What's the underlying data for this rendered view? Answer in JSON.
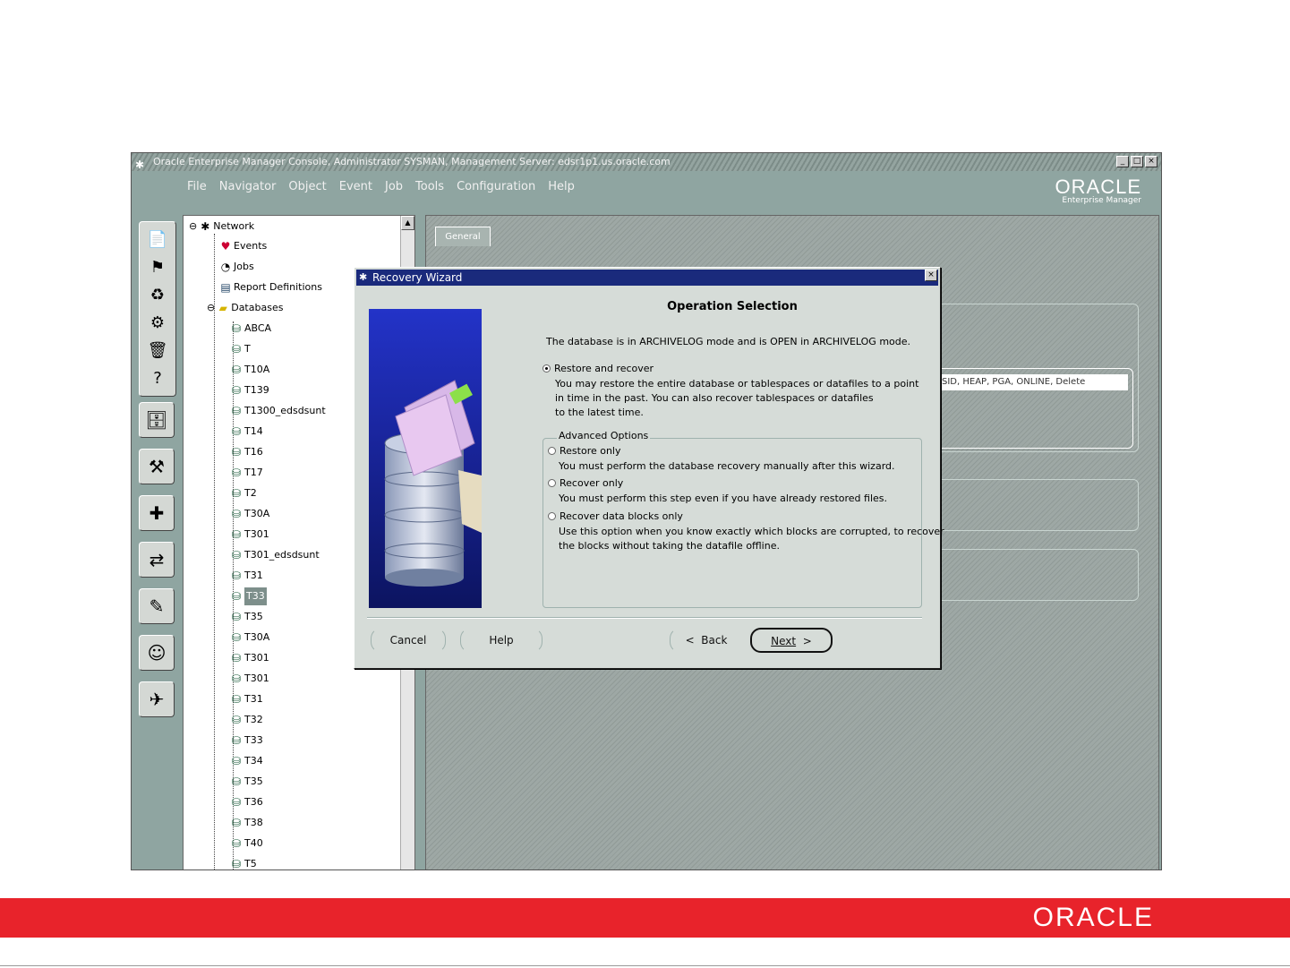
{
  "window": {
    "title": "Oracle Enterprise Manager Console, Administrator SYSMAN, Management Server: edsr1p1.us.oracle.com",
    "controls": [
      "_",
      "□",
      "×"
    ]
  },
  "menu": [
    "File",
    "Navigator",
    "Object",
    "Event",
    "Job",
    "Tools",
    "Configuration",
    "Help"
  ],
  "brand": {
    "wordmark": "ORACLE",
    "subtitle": "Enterprise Manager"
  },
  "toolbar_icons": [
    "new-icon",
    "launch-icon",
    "refresh-icon",
    "discover-icon",
    "trash-icon",
    "help-icon",
    "database-tool-icon",
    "tuning-icon",
    "diagnostics-icon",
    "change-management-icon",
    "configuration-icon",
    "user-icon",
    "wizard-icon"
  ],
  "tree": {
    "root": "Network",
    "items": [
      {
        "label": "Events",
        "level": 1,
        "icon": "events-icon"
      },
      {
        "label": "Jobs",
        "level": 1,
        "icon": "jobs-icon"
      },
      {
        "label": "Report Definitions",
        "level": 1,
        "icon": "report-icon"
      },
      {
        "label": "Databases",
        "level": 1,
        "icon": "folder-icon"
      },
      {
        "label": "ABCA",
        "level": 2,
        "icon": "database-icon"
      },
      {
        "label": "T",
        "level": 2,
        "icon": "database-icon"
      },
      {
        "label": "T10A",
        "level": 2,
        "icon": "database-icon"
      },
      {
        "label": "T139",
        "level": 2,
        "icon": "database-icon"
      },
      {
        "label": "T1300_edsdsunt",
        "level": 2,
        "icon": "database-icon"
      },
      {
        "label": "T14",
        "level": 2,
        "icon": "database-icon"
      },
      {
        "label": "T16",
        "level": 2,
        "icon": "database-icon"
      },
      {
        "label": "T17",
        "level": 2,
        "icon": "database-icon"
      },
      {
        "label": "T2",
        "level": 2,
        "icon": "database-icon"
      },
      {
        "label": "T30A",
        "level": 2,
        "icon": "database-icon"
      },
      {
        "label": "T301",
        "level": 2,
        "icon": "database-icon"
      },
      {
        "label": "T301_edsdsunt",
        "level": 2,
        "icon": "database-icon"
      },
      {
        "label": "T31",
        "level": 2,
        "icon": "database-icon"
      },
      {
        "label": "T33",
        "level": 2,
        "icon": "database-icon",
        "selected": true
      },
      {
        "label": "T35",
        "level": 2,
        "icon": "database-icon"
      },
      {
        "label": "T30A",
        "level": 2,
        "icon": "database-icon"
      },
      {
        "label": "T301",
        "level": 2,
        "icon": "database-icon"
      },
      {
        "label": "T301",
        "level": 2,
        "icon": "database-icon"
      },
      {
        "label": "T31",
        "level": 2,
        "icon": "database-icon"
      },
      {
        "label": "T32",
        "level": 2,
        "icon": "database-icon"
      },
      {
        "label": "T33",
        "level": 2,
        "icon": "database-icon"
      },
      {
        "label": "T34",
        "level": 2,
        "icon": "database-icon"
      },
      {
        "label": "T35",
        "level": 2,
        "icon": "database-icon"
      },
      {
        "label": "T36",
        "level": 2,
        "icon": "database-icon"
      },
      {
        "label": "T38",
        "level": 2,
        "icon": "database-icon"
      },
      {
        "label": "T40",
        "level": 2,
        "icon": "database-icon"
      },
      {
        "label": "T5",
        "level": 2,
        "icon": "database-icon"
      }
    ]
  },
  "right_panel": {
    "tab": "General",
    "field_value": "SID, HEAP, PGA, ONLINE, Delete"
  },
  "dialog": {
    "title": "Recovery Wizard",
    "heading": "Operation Selection",
    "intro": "The database is in ARCHIVELOG mode and is OPEN in ARCHIVELOG mode.",
    "options": [
      {
        "label": "Restore and recover",
        "checked": true,
        "desc": [
          "You may restore the entire database or tablespaces or datafiles to a point",
          "in time in the past. You can also recover tablespaces or datafiles",
          "to the latest time."
        ]
      }
    ],
    "advanced_label": "Advanced Options",
    "advanced_options": [
      {
        "label": "Restore only",
        "checked": false,
        "desc": [
          "You must perform the database recovery manually after this wizard."
        ]
      },
      {
        "label": "Recover only",
        "checked": false,
        "desc": [
          "You must perform this step even if you have already restored files."
        ]
      },
      {
        "label": "Recover data blocks only",
        "checked": false,
        "desc": [
          "Use this option when you know exactly which blocks are corrupted, to recover",
          "the blocks without taking the datafile offline."
        ]
      }
    ],
    "buttons": {
      "cancel": "Cancel",
      "help": "Help",
      "back": "Back",
      "next": "Next"
    }
  },
  "footer": {
    "wordmark": "ORACLE"
  },
  "colors": {
    "app_bg": "#8fa5a1",
    "dialog_bg": "#d6dcd8",
    "dialog_title": "#1a2a7c",
    "footer_red": "#e8232b"
  }
}
